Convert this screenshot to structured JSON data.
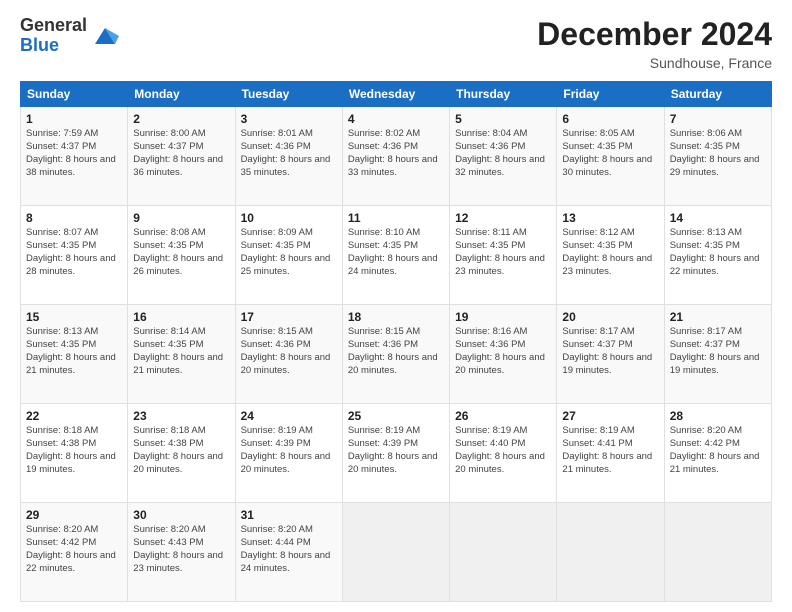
{
  "logo": {
    "general": "General",
    "blue": "Blue"
  },
  "title": "December 2024",
  "subtitle": "Sundhouse, France",
  "days_header": [
    "Sunday",
    "Monday",
    "Tuesday",
    "Wednesday",
    "Thursday",
    "Friday",
    "Saturday"
  ],
  "weeks": [
    [
      {
        "day": "1",
        "sunrise": "7:59 AM",
        "sunset": "4:37 PM",
        "daylight": "8 hours and 38 minutes."
      },
      {
        "day": "2",
        "sunrise": "8:00 AM",
        "sunset": "4:37 PM",
        "daylight": "8 hours and 36 minutes."
      },
      {
        "day": "3",
        "sunrise": "8:01 AM",
        "sunset": "4:36 PM",
        "daylight": "8 hours and 35 minutes."
      },
      {
        "day": "4",
        "sunrise": "8:02 AM",
        "sunset": "4:36 PM",
        "daylight": "8 hours and 33 minutes."
      },
      {
        "day": "5",
        "sunrise": "8:04 AM",
        "sunset": "4:36 PM",
        "daylight": "8 hours and 32 minutes."
      },
      {
        "day": "6",
        "sunrise": "8:05 AM",
        "sunset": "4:35 PM",
        "daylight": "8 hours and 30 minutes."
      },
      {
        "day": "7",
        "sunrise": "8:06 AM",
        "sunset": "4:35 PM",
        "daylight": "8 hours and 29 minutes."
      }
    ],
    [
      {
        "day": "8",
        "sunrise": "8:07 AM",
        "sunset": "4:35 PM",
        "daylight": "8 hours and 28 minutes."
      },
      {
        "day": "9",
        "sunrise": "8:08 AM",
        "sunset": "4:35 PM",
        "daylight": "8 hours and 26 minutes."
      },
      {
        "day": "10",
        "sunrise": "8:09 AM",
        "sunset": "4:35 PM",
        "daylight": "8 hours and 25 minutes."
      },
      {
        "day": "11",
        "sunrise": "8:10 AM",
        "sunset": "4:35 PM",
        "daylight": "8 hours and 24 minutes."
      },
      {
        "day": "12",
        "sunrise": "8:11 AM",
        "sunset": "4:35 PM",
        "daylight": "8 hours and 23 minutes."
      },
      {
        "day": "13",
        "sunrise": "8:12 AM",
        "sunset": "4:35 PM",
        "daylight": "8 hours and 23 minutes."
      },
      {
        "day": "14",
        "sunrise": "8:13 AM",
        "sunset": "4:35 PM",
        "daylight": "8 hours and 22 minutes."
      }
    ],
    [
      {
        "day": "15",
        "sunrise": "8:13 AM",
        "sunset": "4:35 PM",
        "daylight": "8 hours and 21 minutes."
      },
      {
        "day": "16",
        "sunrise": "8:14 AM",
        "sunset": "4:35 PM",
        "daylight": "8 hours and 21 minutes."
      },
      {
        "day": "17",
        "sunrise": "8:15 AM",
        "sunset": "4:36 PM",
        "daylight": "8 hours and 20 minutes."
      },
      {
        "day": "18",
        "sunrise": "8:15 AM",
        "sunset": "4:36 PM",
        "daylight": "8 hours and 20 minutes."
      },
      {
        "day": "19",
        "sunrise": "8:16 AM",
        "sunset": "4:36 PM",
        "daylight": "8 hours and 20 minutes."
      },
      {
        "day": "20",
        "sunrise": "8:17 AM",
        "sunset": "4:37 PM",
        "daylight": "8 hours and 19 minutes."
      },
      {
        "day": "21",
        "sunrise": "8:17 AM",
        "sunset": "4:37 PM",
        "daylight": "8 hours and 19 minutes."
      }
    ],
    [
      {
        "day": "22",
        "sunrise": "8:18 AM",
        "sunset": "4:38 PM",
        "daylight": "8 hours and 19 minutes."
      },
      {
        "day": "23",
        "sunrise": "8:18 AM",
        "sunset": "4:38 PM",
        "daylight": "8 hours and 20 minutes."
      },
      {
        "day": "24",
        "sunrise": "8:19 AM",
        "sunset": "4:39 PM",
        "daylight": "8 hours and 20 minutes."
      },
      {
        "day": "25",
        "sunrise": "8:19 AM",
        "sunset": "4:39 PM",
        "daylight": "8 hours and 20 minutes."
      },
      {
        "day": "26",
        "sunrise": "8:19 AM",
        "sunset": "4:40 PM",
        "daylight": "8 hours and 20 minutes."
      },
      {
        "day": "27",
        "sunrise": "8:19 AM",
        "sunset": "4:41 PM",
        "daylight": "8 hours and 21 minutes."
      },
      {
        "day": "28",
        "sunrise": "8:20 AM",
        "sunset": "4:42 PM",
        "daylight": "8 hours and 21 minutes."
      }
    ],
    [
      {
        "day": "29",
        "sunrise": "8:20 AM",
        "sunset": "4:42 PM",
        "daylight": "8 hours and 22 minutes."
      },
      {
        "day": "30",
        "sunrise": "8:20 AM",
        "sunset": "4:43 PM",
        "daylight": "8 hours and 23 minutes."
      },
      {
        "day": "31",
        "sunrise": "8:20 AM",
        "sunset": "4:44 PM",
        "daylight": "8 hours and 24 minutes."
      },
      null,
      null,
      null,
      null
    ]
  ],
  "labels": {
    "sunrise": "Sunrise:",
    "sunset": "Sunset:",
    "daylight": "Daylight:"
  }
}
